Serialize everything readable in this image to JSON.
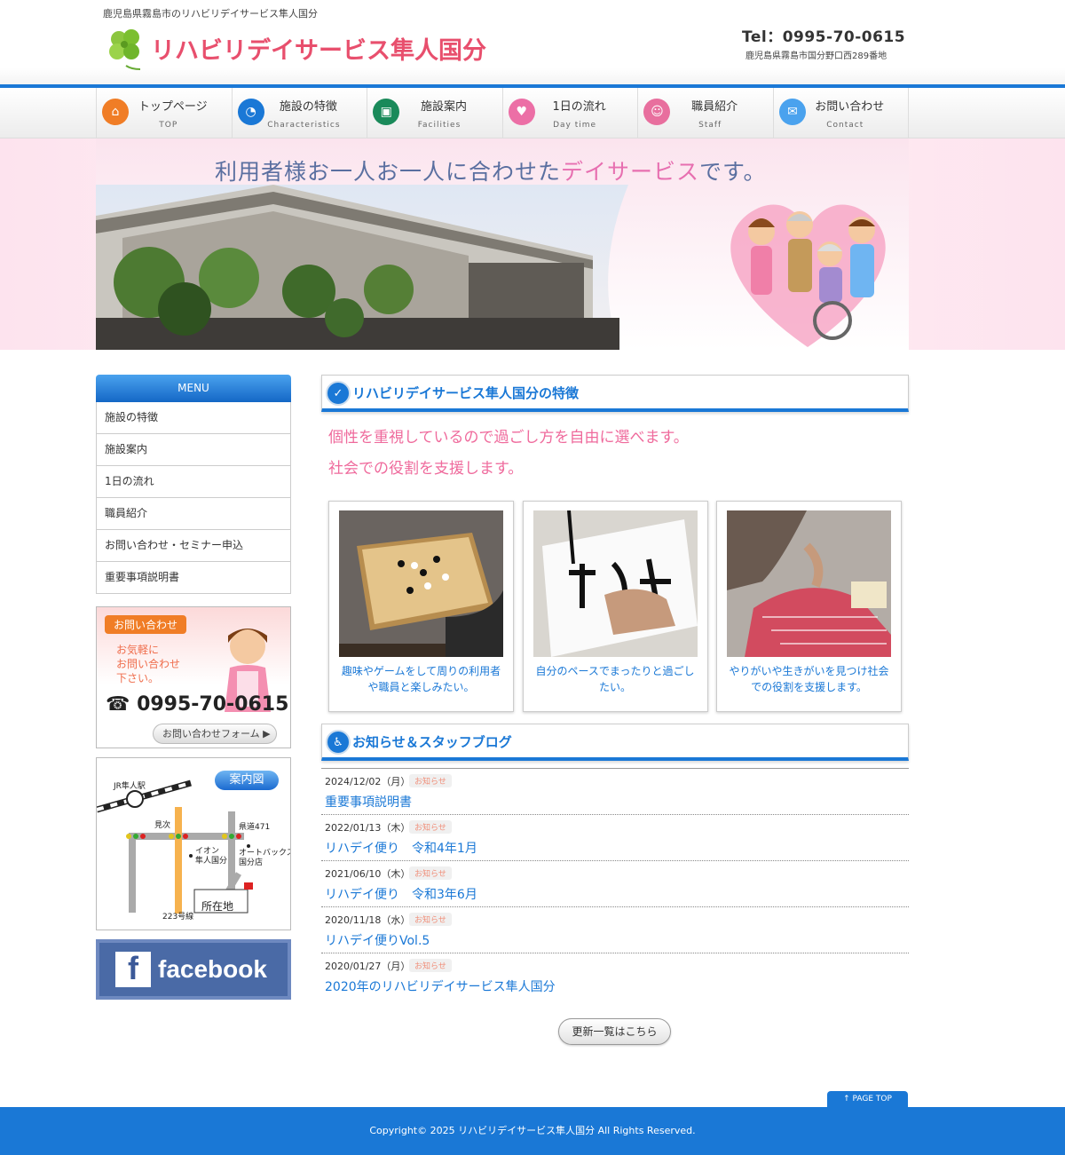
{
  "header": {
    "tagline": "鹿児島県霧島市のリハビリデイサービス隼人国分",
    "logo_text": "リハビリデイサービス隼人国分",
    "tel": "Tel：0995-70-0615",
    "address": "鹿児島県霧島市国分野口西289番地"
  },
  "nav": [
    {
      "label": "トップページ",
      "sub": "TOP",
      "icon": "home-icon",
      "color": "#f07d26"
    },
    {
      "label": "施設の特徴",
      "sub": "Characteristics",
      "icon": "wifi-icon",
      "color": "#1a78d6"
    },
    {
      "label": "施設案内",
      "sub": "Facilities",
      "icon": "camera-icon",
      "color": "#1a8a5a"
    },
    {
      "label": "1日の流れ",
      "sub": "Day time",
      "icon": "heart-icon",
      "color": "#ec6fa6"
    },
    {
      "label": "職員紹介",
      "sub": "Staff",
      "icon": "people-icon",
      "color": "#e86f9e"
    },
    {
      "label": "お問い合わせ",
      "sub": "Contact",
      "icon": "mail-icon",
      "color": "#4aa2ee"
    }
  ],
  "hero": {
    "catch_a": "利用者様お一人お一人に合わせた",
    "catch_b": "デイサービス",
    "catch_c": "です。"
  },
  "sidebar": {
    "menu_title": "MENU",
    "items": [
      "施設の特徴",
      "施設案内",
      "1日の流れ",
      "職員紹介",
      "お問い合わせ・セミナー申込",
      "重要事項説明書"
    ],
    "contact": {
      "tag": "お問い合わせ",
      "msg1": "お気軽に",
      "msg2": "お問い合わせ",
      "msg3": "下さい。",
      "tel": "☎ 0995-70-0615",
      "form_label": "お問い合わせフォーム ▶"
    },
    "map": {
      "title": "案内図",
      "station": "JR隼人駅",
      "mitsugi": "見次",
      "route471": "県道471",
      "aeon1": "イオン",
      "aeon2": "隼人国分",
      "autobacs1": "オートバックス",
      "autobacs2": "国分店",
      "location": "所在地",
      "route223": "223号線"
    },
    "facebook": "facebook"
  },
  "main": {
    "feature_title": "リハビリデイサービス隼人国分の特徴",
    "intro1": "個性を重視しているので過ごし方を自由に選べます。",
    "intro2": "社会での役割を支援します。",
    "cards": [
      {
        "text": "趣味やゲームをして周りの利用者や職員と楽しみたい。"
      },
      {
        "text": "自分のペースでまったりと過ごしたい。"
      },
      {
        "text": "やりがいや生きがいを見つけ社会での役割を支援します。"
      }
    ],
    "news_title": "お知らせ＆スタッフブログ",
    "news": [
      {
        "date": "2024/12/02（月）",
        "tag": "お知らせ",
        "title": "重要事項説明書"
      },
      {
        "date": "2022/01/13（木）",
        "tag": "お知らせ",
        "title": "リハデイ便り　令和4年1月"
      },
      {
        "date": "2021/06/10（木）",
        "tag": "お知らせ",
        "title": "リハデイ便り　令和3年6月"
      },
      {
        "date": "2020/11/18（水）",
        "tag": "お知らせ",
        "title": "リハデイ便りVol.5"
      },
      {
        "date": "2020/01/27（月）",
        "tag": "お知らせ",
        "title": "2020年のリハビリデイサービス隼人国分"
      }
    ],
    "more_label": "更新一覧はこちら"
  },
  "footer": {
    "pagetop": "↑ PAGE TOP",
    "copyright": "Copyright© 2025 リハビリデイサービス隼人国分 All Rights Reserved."
  }
}
